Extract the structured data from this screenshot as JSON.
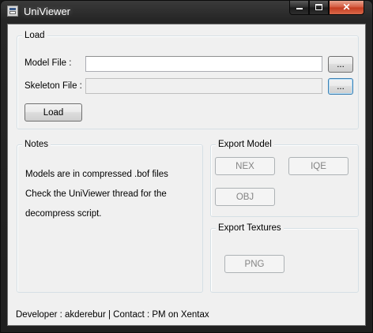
{
  "window": {
    "title": "UniViewer",
    "minimize_symbol": "",
    "maximize_symbol": "",
    "close_symbol": "✕"
  },
  "load_group": {
    "legend": "Load",
    "model_file_label": "Model File :",
    "model_file_value": "",
    "model_browse_label": "...",
    "skeleton_file_label": "Skeleton File :",
    "skeleton_file_value": "",
    "skeleton_browse_label": "...",
    "load_button_label": "Load"
  },
  "notes_group": {
    "legend": "Notes",
    "lines": [
      "Models are in compressed .bof files",
      "Check the UniViewer thread for the",
      "decompress script."
    ]
  },
  "export_model_group": {
    "legend": "Export Model",
    "nex_label": "NEX",
    "iqe_label": "IQE",
    "obj_label": "OBJ"
  },
  "export_textures_group": {
    "legend": "Export Textures",
    "png_label": "PNG"
  },
  "status_bar": {
    "text": "Developer : akderebur  |  Contact : PM on Xentax"
  },
  "icons": {
    "app": "app-window-icon"
  }
}
